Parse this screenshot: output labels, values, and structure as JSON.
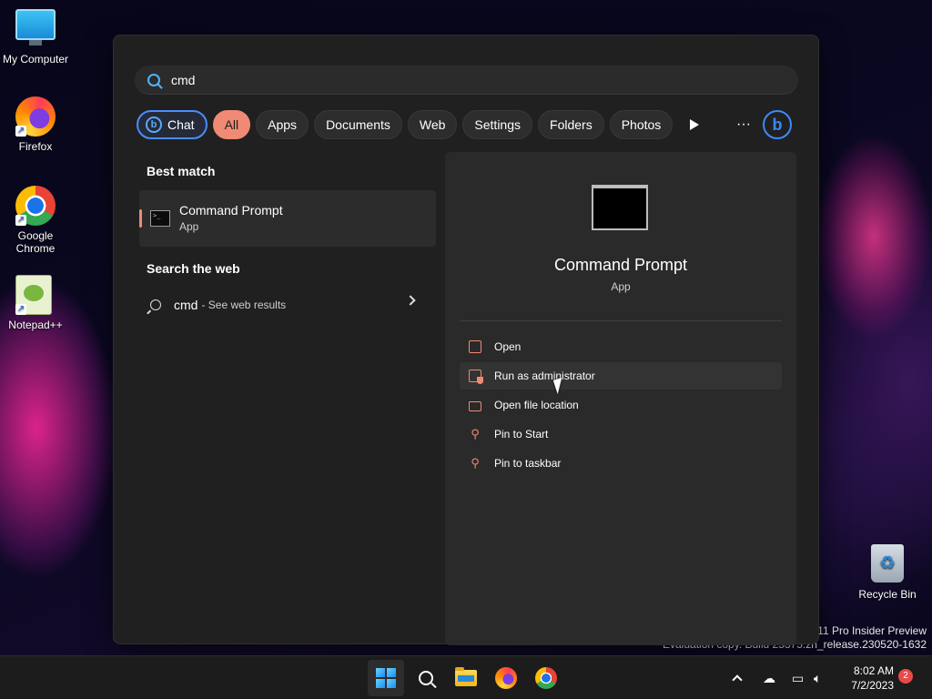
{
  "desktop": {
    "icons": [
      {
        "label": "My Computer"
      },
      {
        "label": "Firefox"
      },
      {
        "label": "Google Chrome"
      },
      {
        "label": "Notepad++"
      },
      {
        "label": "Recycle Bin"
      }
    ],
    "watermark": {
      "line1": "s 11 Pro Insider Preview",
      "line2": "Evaluation copy. Build 25375.zn_release.230520-1632"
    }
  },
  "search": {
    "query": "cmd",
    "filters": [
      {
        "label": "Chat"
      },
      {
        "label": "All"
      },
      {
        "label": "Apps"
      },
      {
        "label": "Documents"
      },
      {
        "label": "Web"
      },
      {
        "label": "Settings"
      },
      {
        "label": "Folders"
      },
      {
        "label": "Photos"
      }
    ],
    "more_label": "···",
    "bing_label": "b"
  },
  "results": {
    "best_match_title": "Best match",
    "best_match": {
      "name": "Command Prompt",
      "type": "App"
    },
    "web_title": "Search the web",
    "web_query": "cmd",
    "web_hint": "- See web results"
  },
  "detail": {
    "name": "Command Prompt",
    "type": "App",
    "actions": [
      {
        "label": "Open"
      },
      {
        "label": "Run as administrator"
      },
      {
        "label": "Open file location"
      },
      {
        "label": "Pin to Start"
      },
      {
        "label": "Pin to taskbar"
      }
    ]
  },
  "taskbar": {
    "time": "8:02 AM",
    "date": "7/2/2023",
    "notification_count": "2"
  },
  "colors": {
    "accent": "#f08a74",
    "chat_border": "#4a8cff",
    "panel_bg": "#202020"
  }
}
